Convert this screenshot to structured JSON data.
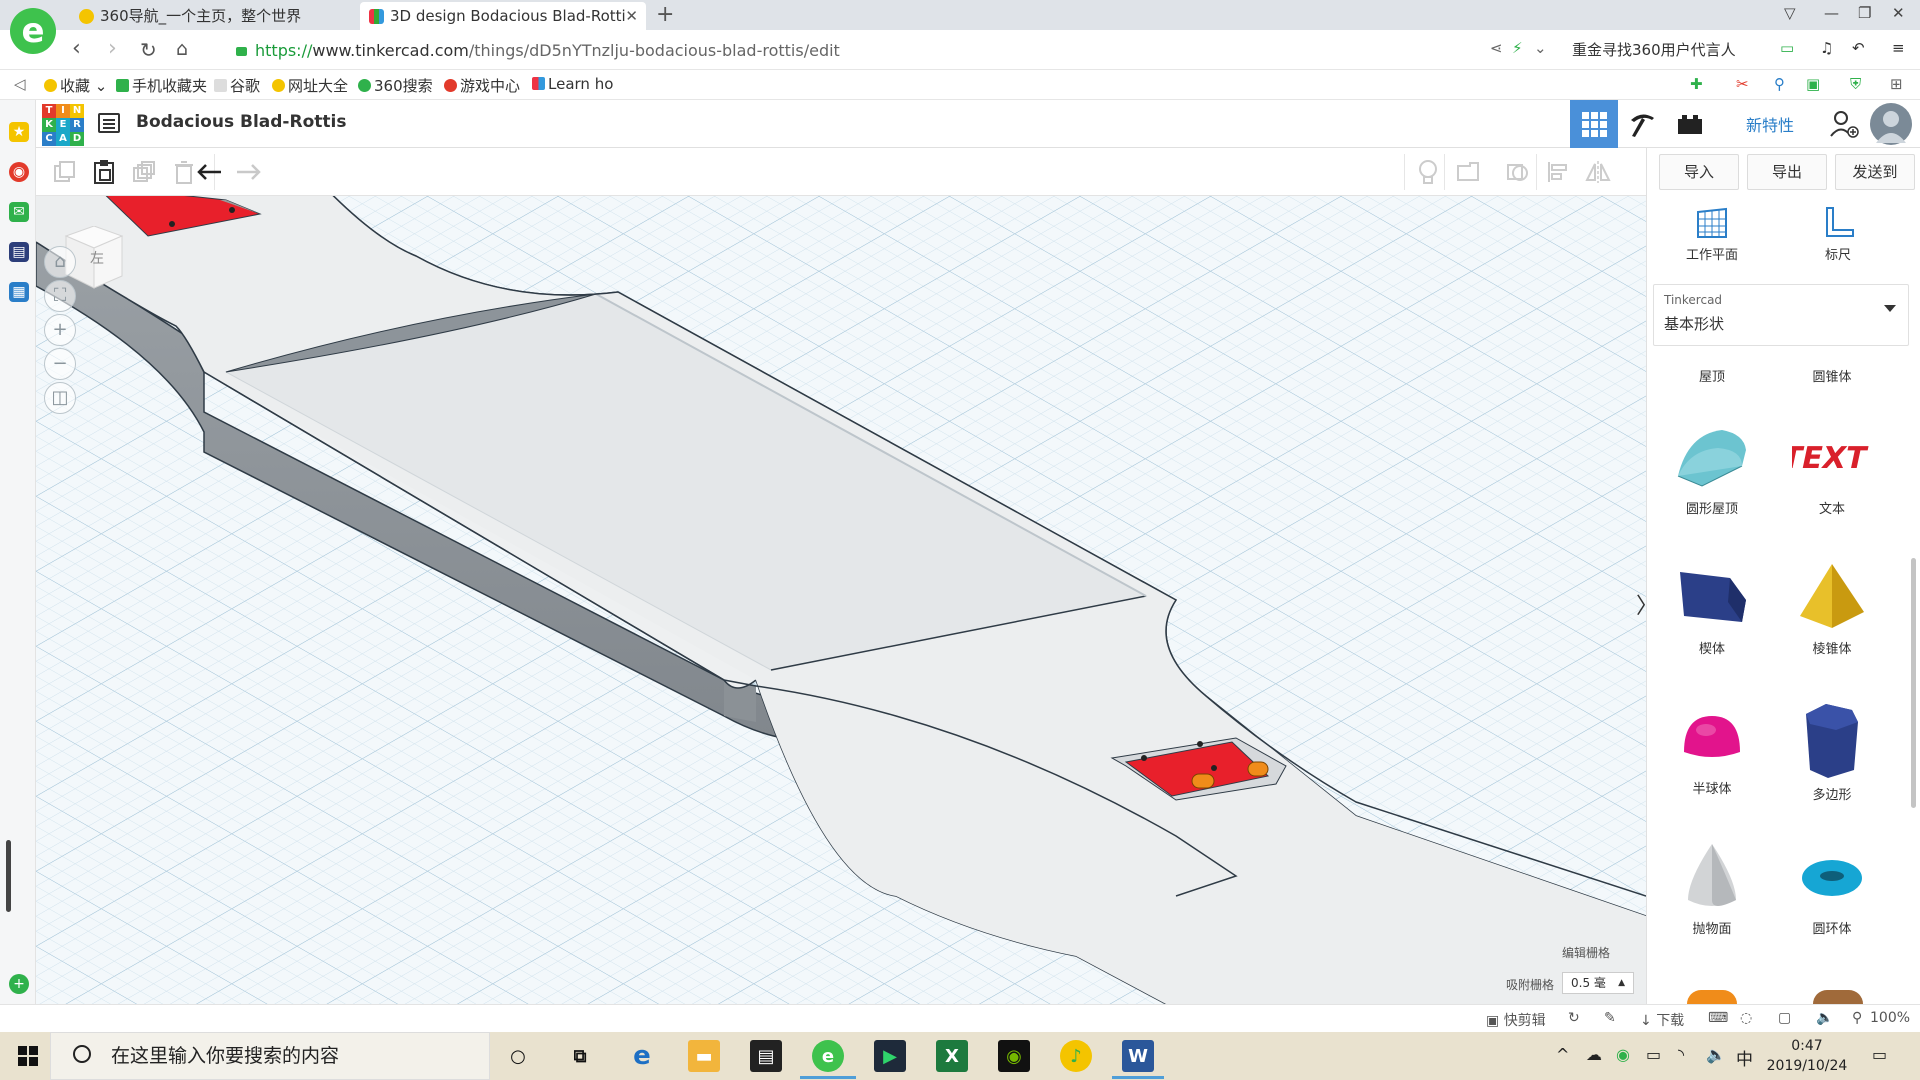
{
  "browser": {
    "tabs": [
      {
        "title": "360导航_一个主页，整个世界",
        "active": false
      },
      {
        "title": "3D design Bodacious Blad-Rotti",
        "active": true
      }
    ],
    "url_scheme": "https://",
    "url_host": "www.tinkercad.com",
    "url_path": "/things/dD5nYTnzlju-bodacious-blad-rottis/edit",
    "address_promo": "重金寻找360用户代言人",
    "bookmarks": [
      "收藏",
      "手机收藏夹",
      "谷歌",
      "网址大全",
      "360搜索",
      "游戏中心",
      "Learn ho"
    ]
  },
  "tinkercad": {
    "logo_letters": [
      "T",
      "I",
      "N",
      "K",
      "E",
      "R",
      "C",
      "A",
      "D"
    ],
    "design_title": "Bodacious Blad-Rottis",
    "whats_new": "新特性",
    "actions": {
      "import": "导入",
      "export": "导出",
      "send_to": "发送到"
    },
    "tools": {
      "workplane": "工作平面",
      "ruler": "标尺"
    },
    "library": {
      "provider": "Tinkercad",
      "category": "基本形状"
    },
    "shapes_top": {
      "left": "屋顶",
      "right": "圆锥体"
    },
    "shapes": [
      {
        "label": "圆形屋顶",
        "icon": "round-roof-icon"
      },
      {
        "label": "文本",
        "icon": "text-shape-icon"
      },
      {
        "label": "楔体",
        "icon": "wedge-icon"
      },
      {
        "label": "棱锥体",
        "icon": "pyramid-icon"
      },
      {
        "label": "半球体",
        "icon": "half-sphere-icon"
      },
      {
        "label": "多边形",
        "icon": "polygon-icon"
      },
      {
        "label": "抛物面",
        "icon": "paraboloid-icon"
      },
      {
        "label": "圆环体",
        "icon": "torus-icon"
      }
    ],
    "viewcube_label": "左",
    "grid": {
      "edit_label": "编辑栅格",
      "snap_label": "吸附栅格",
      "snap_value": "0.5 毫"
    }
  },
  "statusbar": {
    "quick_cut": "快剪辑",
    "download": "下载",
    "zoom": "100%"
  },
  "taskbar": {
    "search_placeholder": "在这里输入你要搜索的内容",
    "ime": "中",
    "time": "0:47",
    "date": "2019/10/24"
  },
  "colors": {
    "accent": "#4a90d9",
    "grid_bg": "#f3f8fb",
    "part_red": "#e8202b",
    "link": "#2a7ec8"
  }
}
